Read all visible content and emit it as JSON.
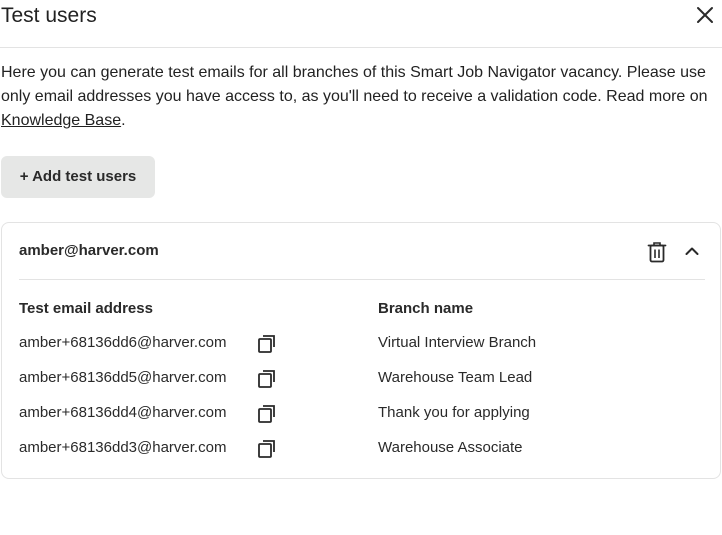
{
  "header": {
    "title": "Test users"
  },
  "intro": {
    "text": "Here you can generate test emails for all branches of this Smart Job Navigator vacancy. Please use only email addresses you have access to, as you'll need to receive a validation code. Read more on ",
    "link_label": "Knowledge Base",
    "suffix": "."
  },
  "add_button": {
    "label": "+ Add test users"
  },
  "card": {
    "email": "amber@harver.com",
    "columns": {
      "email": "Test email address",
      "branch": "Branch name"
    },
    "rows": [
      {
        "email": "amber+68136dd6@harver.com",
        "branch": "Virtual Interview Branch"
      },
      {
        "email": "amber+68136dd5@harver.com",
        "branch": "Warehouse Team Lead"
      },
      {
        "email": "amber+68136dd4@harver.com",
        "branch": "Thank you for applying"
      },
      {
        "email": "amber+68136dd3@harver.com",
        "branch": "Warehouse Associate"
      }
    ]
  },
  "icons": {
    "close": "close-icon",
    "delete": "trash-icon",
    "collapse": "chevron-up-icon",
    "copy": "copy-icon"
  }
}
